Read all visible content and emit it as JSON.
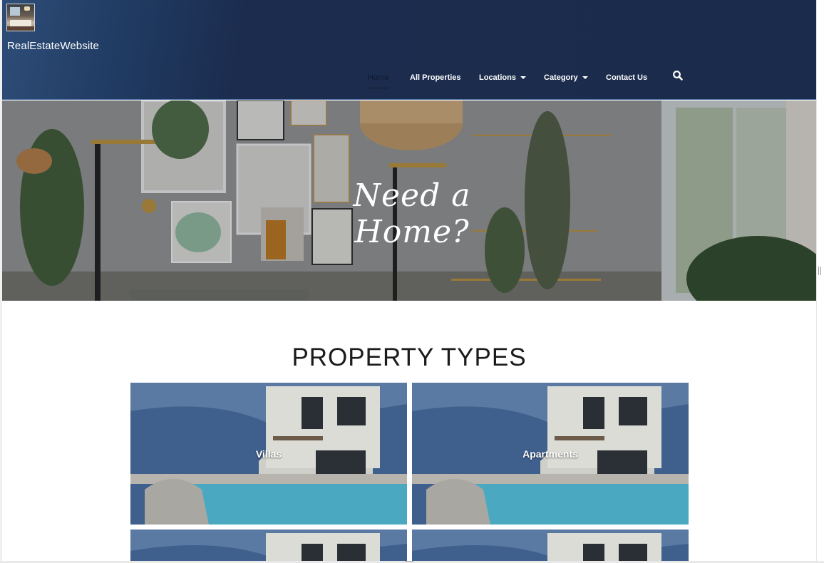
{
  "site": {
    "title": "RealEstateWebsite"
  },
  "nav": {
    "items": [
      {
        "label": "Home",
        "active": true
      },
      {
        "label": "All Properties"
      },
      {
        "label": "Locations",
        "dropdown": true
      },
      {
        "label": "Category",
        "dropdown": true
      },
      {
        "label": "Contact Us"
      }
    ],
    "search_icon": "search-icon"
  },
  "hero": {
    "heading": "Need a Home?"
  },
  "property_types": {
    "title": "PROPERTY TYPES",
    "cards": [
      {
        "label": "Villas"
      },
      {
        "label": "Apartments"
      },
      {
        "label": ""
      },
      {
        "label": ""
      }
    ]
  },
  "colors": {
    "header_bg": "#1b2b4c",
    "header_accent": "#2d4d78",
    "active_nav_text": "#111a2c",
    "section_title": "#1b1b1b"
  }
}
